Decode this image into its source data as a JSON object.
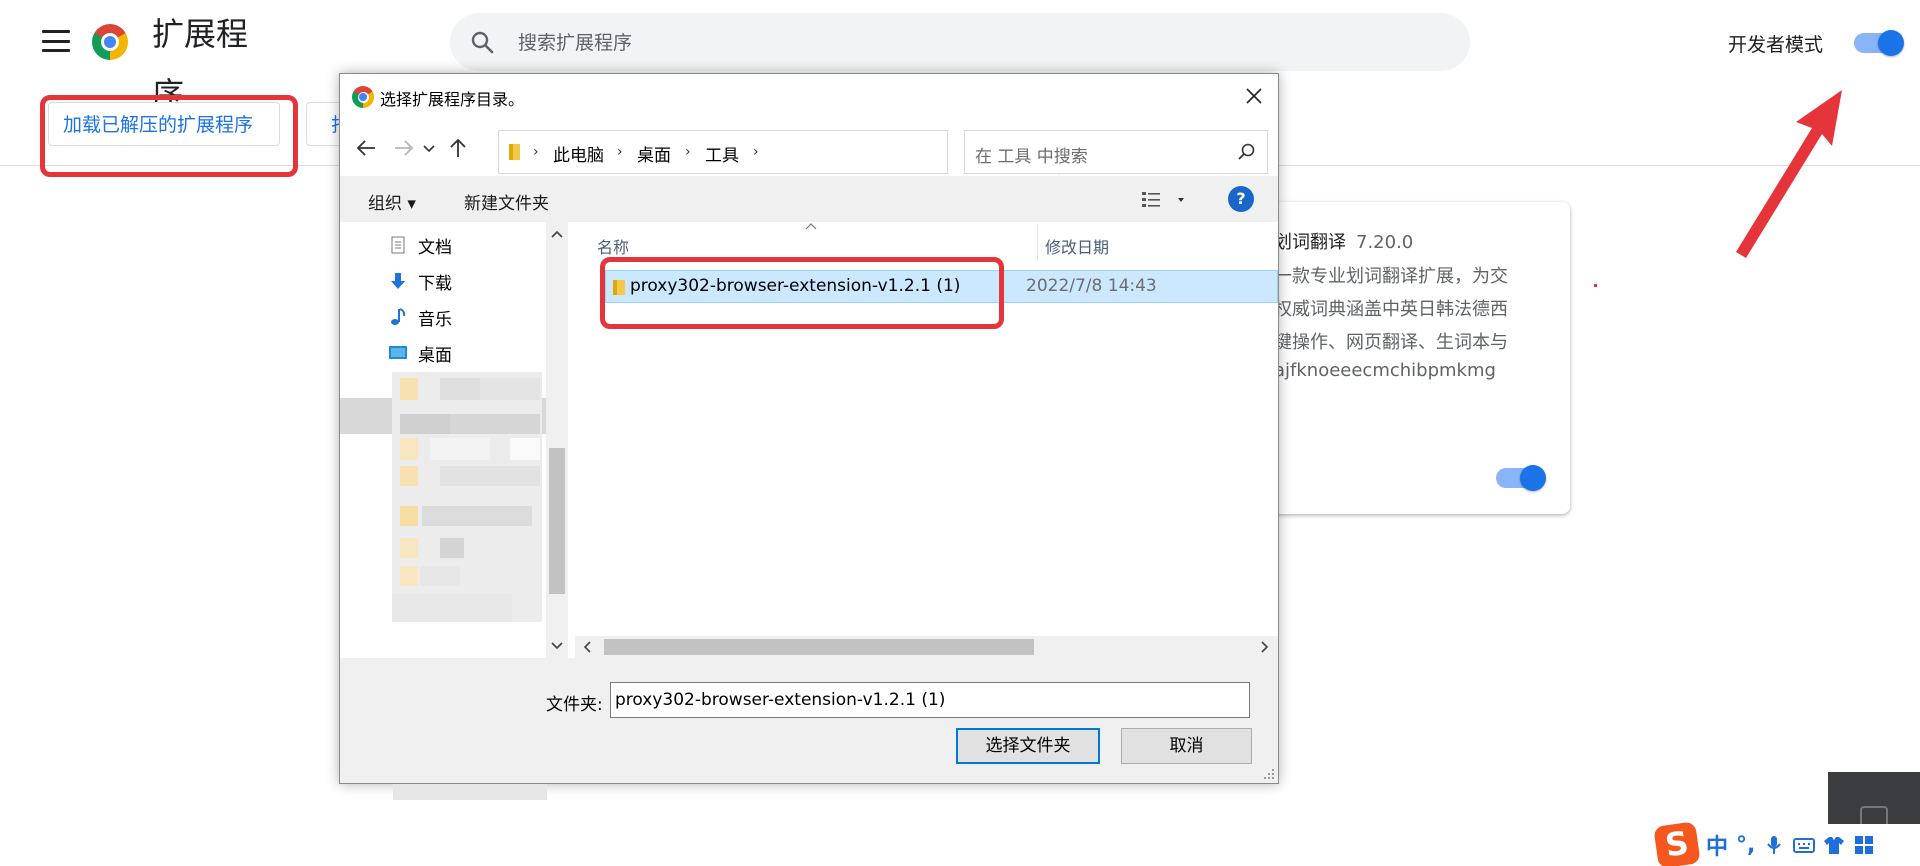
{
  "page": {
    "title": "扩展程序",
    "search_placeholder": "搜索扩展程序",
    "developer_mode_label": "开发者模式",
    "developer_mode_on": true,
    "load_unpacked_button": "加载已解压的扩展程序",
    "pack_button_partial": "打"
  },
  "extension_card": {
    "name_partial": "划词翻译",
    "version": "7.20.0",
    "description_lines": [
      "一款专业划词翻译扩展，为交",
      "权威词典涵盖中英日韩法德西",
      "键操作、网页翻译、生词本与"
    ],
    "id_partial": "ajfknoeeecmchibpmkmg",
    "enabled": true
  },
  "dialog": {
    "title": "选择扩展程序目录。",
    "breadcrumbs": [
      "此电脑",
      "桌面",
      "工具"
    ],
    "search_placeholder": "在 工具 中搜索",
    "toolbar": {
      "organize": "组织 ▾",
      "new_folder": "新建文件夹",
      "help": "?"
    },
    "nav_items": [
      {
        "label": "文档",
        "icon": "document-icon"
      },
      {
        "label": "下载",
        "icon": "download-icon"
      },
      {
        "label": "音乐",
        "icon": "music-icon"
      },
      {
        "label": "桌面",
        "icon": "desktop-icon"
      }
    ],
    "columns": {
      "name": "名称",
      "modified": "修改日期"
    },
    "files": [
      {
        "name": "proxy302-browser-extension-v1.2.1 (1)",
        "modified": "2022/7/8 14:43",
        "selected": true
      }
    ],
    "folder_label": "文件夹:",
    "folder_value": "proxy302-browser-extension-v1.2.1 (1)",
    "select_button": "选择文件夹",
    "cancel_button": "取消"
  },
  "ime": {
    "brand": "S",
    "mode": "中",
    "punct": "°,"
  },
  "colors": {
    "accent": "#1a73e8",
    "highlight": "#e5353b",
    "selection": "#cce8ff"
  }
}
